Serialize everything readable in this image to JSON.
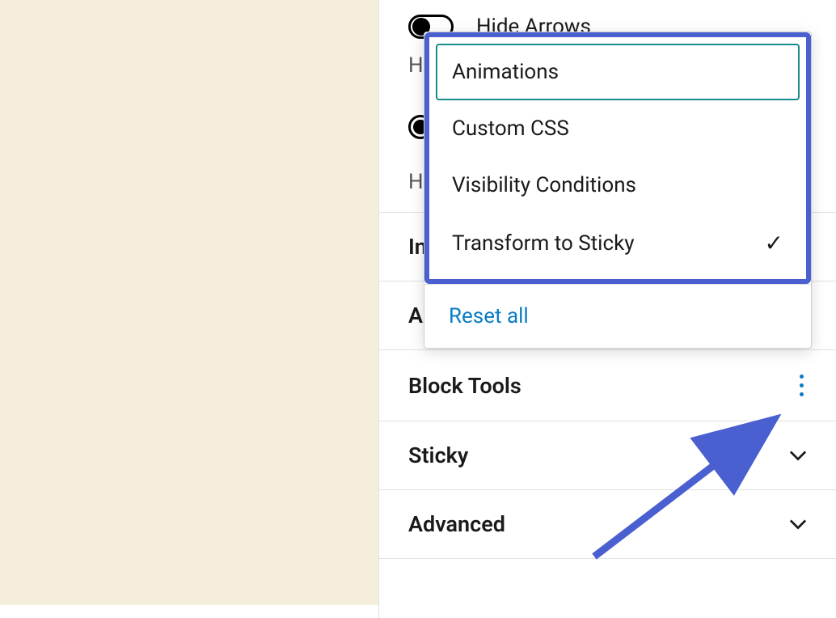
{
  "settings": {
    "hideArrows": {
      "label": "Hide Arrows",
      "subPrefix": "H"
    },
    "radioOption": {
      "subPrefix": "H"
    }
  },
  "panels": {
    "in": "In",
    "a": "A",
    "blockTools": "Block Tools",
    "sticky": "Sticky",
    "advanced": "Advanced"
  },
  "popover": {
    "items": {
      "animations": "Animations",
      "customCss": "Custom CSS",
      "visibility": "Visibility Conditions",
      "sticky": "Transform to Sticky"
    },
    "reset": "Reset all"
  }
}
